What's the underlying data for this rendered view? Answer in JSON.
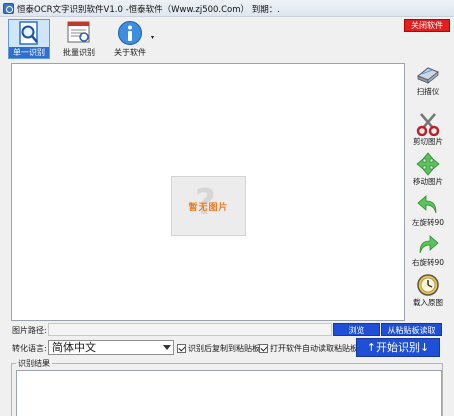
{
  "window": {
    "title": "恒泰OCR文字识别软件V1.0 -恒泰软件（Www.zj500.Com）  到期：."
  },
  "toolbar": {
    "single_label": "单一识别",
    "batch_label": "批量识别",
    "about_label": "关于软件",
    "about_caret": "▾",
    "close_label": "关闭软件"
  },
  "image_area": {
    "placeholder_glyph": "?",
    "placeholder_text": "暂无图片"
  },
  "side_tools": {
    "scanner": "扫描仪",
    "cut": "剪切图片",
    "move": "移动图片",
    "rotate_left": "左旋转90",
    "rotate_right": "右旋转90",
    "load_original": "载入原图"
  },
  "path_row": {
    "label": "图片路径:",
    "value": "",
    "browse_label": "浏览",
    "clipboard_label": "从粘贴板读取"
  },
  "language_row": {
    "label": "转化语言:",
    "selected": "简体中文",
    "copy_checkbox_label": "识别后复制到粘贴板",
    "copy_checked": true,
    "auto_checkbox_label": "打开软件自动读取粘贴板",
    "auto_checked": true,
    "start_label": "↑开始识别↓"
  },
  "result": {
    "label": "识别结果",
    "text": ""
  },
  "colors": {
    "accent_blue": "#1e4fd6",
    "close_red": "#e02020",
    "placeholder_orange": "#ef7a22"
  }
}
